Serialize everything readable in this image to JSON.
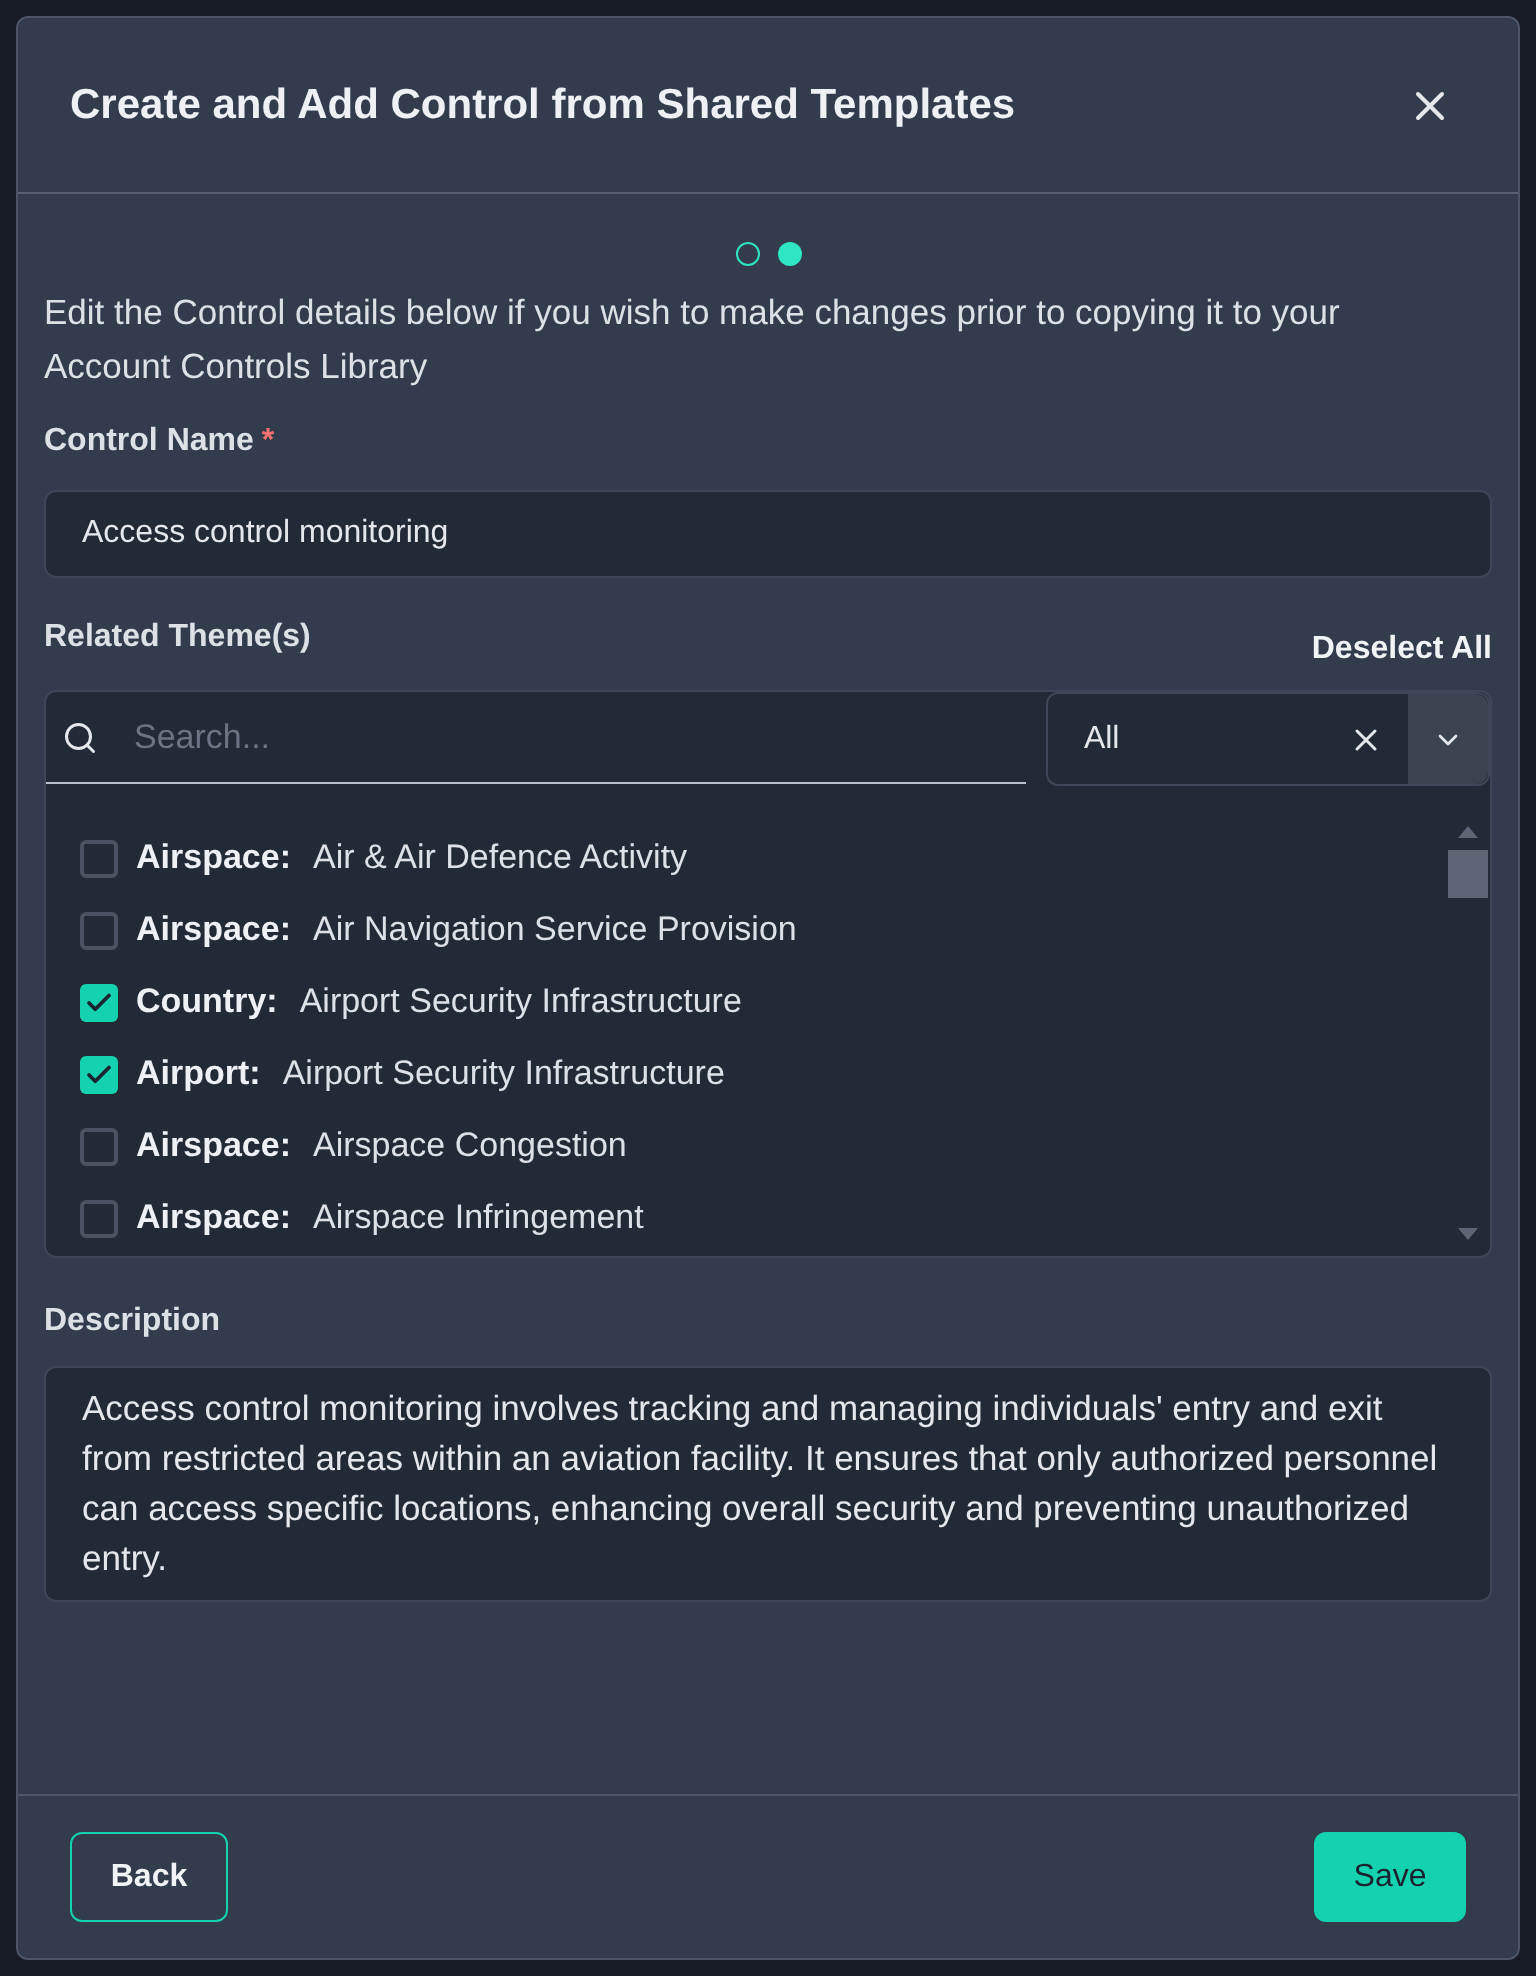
{
  "dialog": {
    "title": "Create and Add Control from Shared Templates"
  },
  "steps": [
    {
      "selected": false
    },
    {
      "selected": true
    }
  ],
  "intro": "Edit the Control details below if you wish to make changes prior to copying it to your Account Controls Library",
  "control_name": {
    "label": "Control Name",
    "required_mark": "*",
    "value": "Access control monitoring"
  },
  "themes": {
    "label": "Related Theme(s)",
    "deselect_all": "Deselect All",
    "search": {
      "placeholder": "Search..."
    },
    "filter": {
      "value": "All"
    },
    "items": [
      {
        "category": "Airspace:",
        "name": "Air & Air Defence Activity",
        "checked": false
      },
      {
        "category": "Airspace:",
        "name": "Air Navigation Service Provision",
        "checked": false
      },
      {
        "category": "Country:",
        "name": "Airport Security Infrastructure",
        "checked": true
      },
      {
        "category": "Airport:",
        "name": "Airport Security Infrastructure",
        "checked": true
      },
      {
        "category": "Airspace:",
        "name": "Airspace Congestion",
        "checked": false
      },
      {
        "category": "Airspace:",
        "name": "Airspace Infringement",
        "checked": false
      }
    ]
  },
  "description": {
    "label": "Description",
    "value": "Access control monitoring involves tracking and managing individuals' entry and exit from restricted areas within an aviation facility. It ensures that only authorized personnel can access specific locations, enhancing overall security and preventing unauthorized entry."
  },
  "buttons": {
    "back": "Back",
    "save": "Save"
  }
}
